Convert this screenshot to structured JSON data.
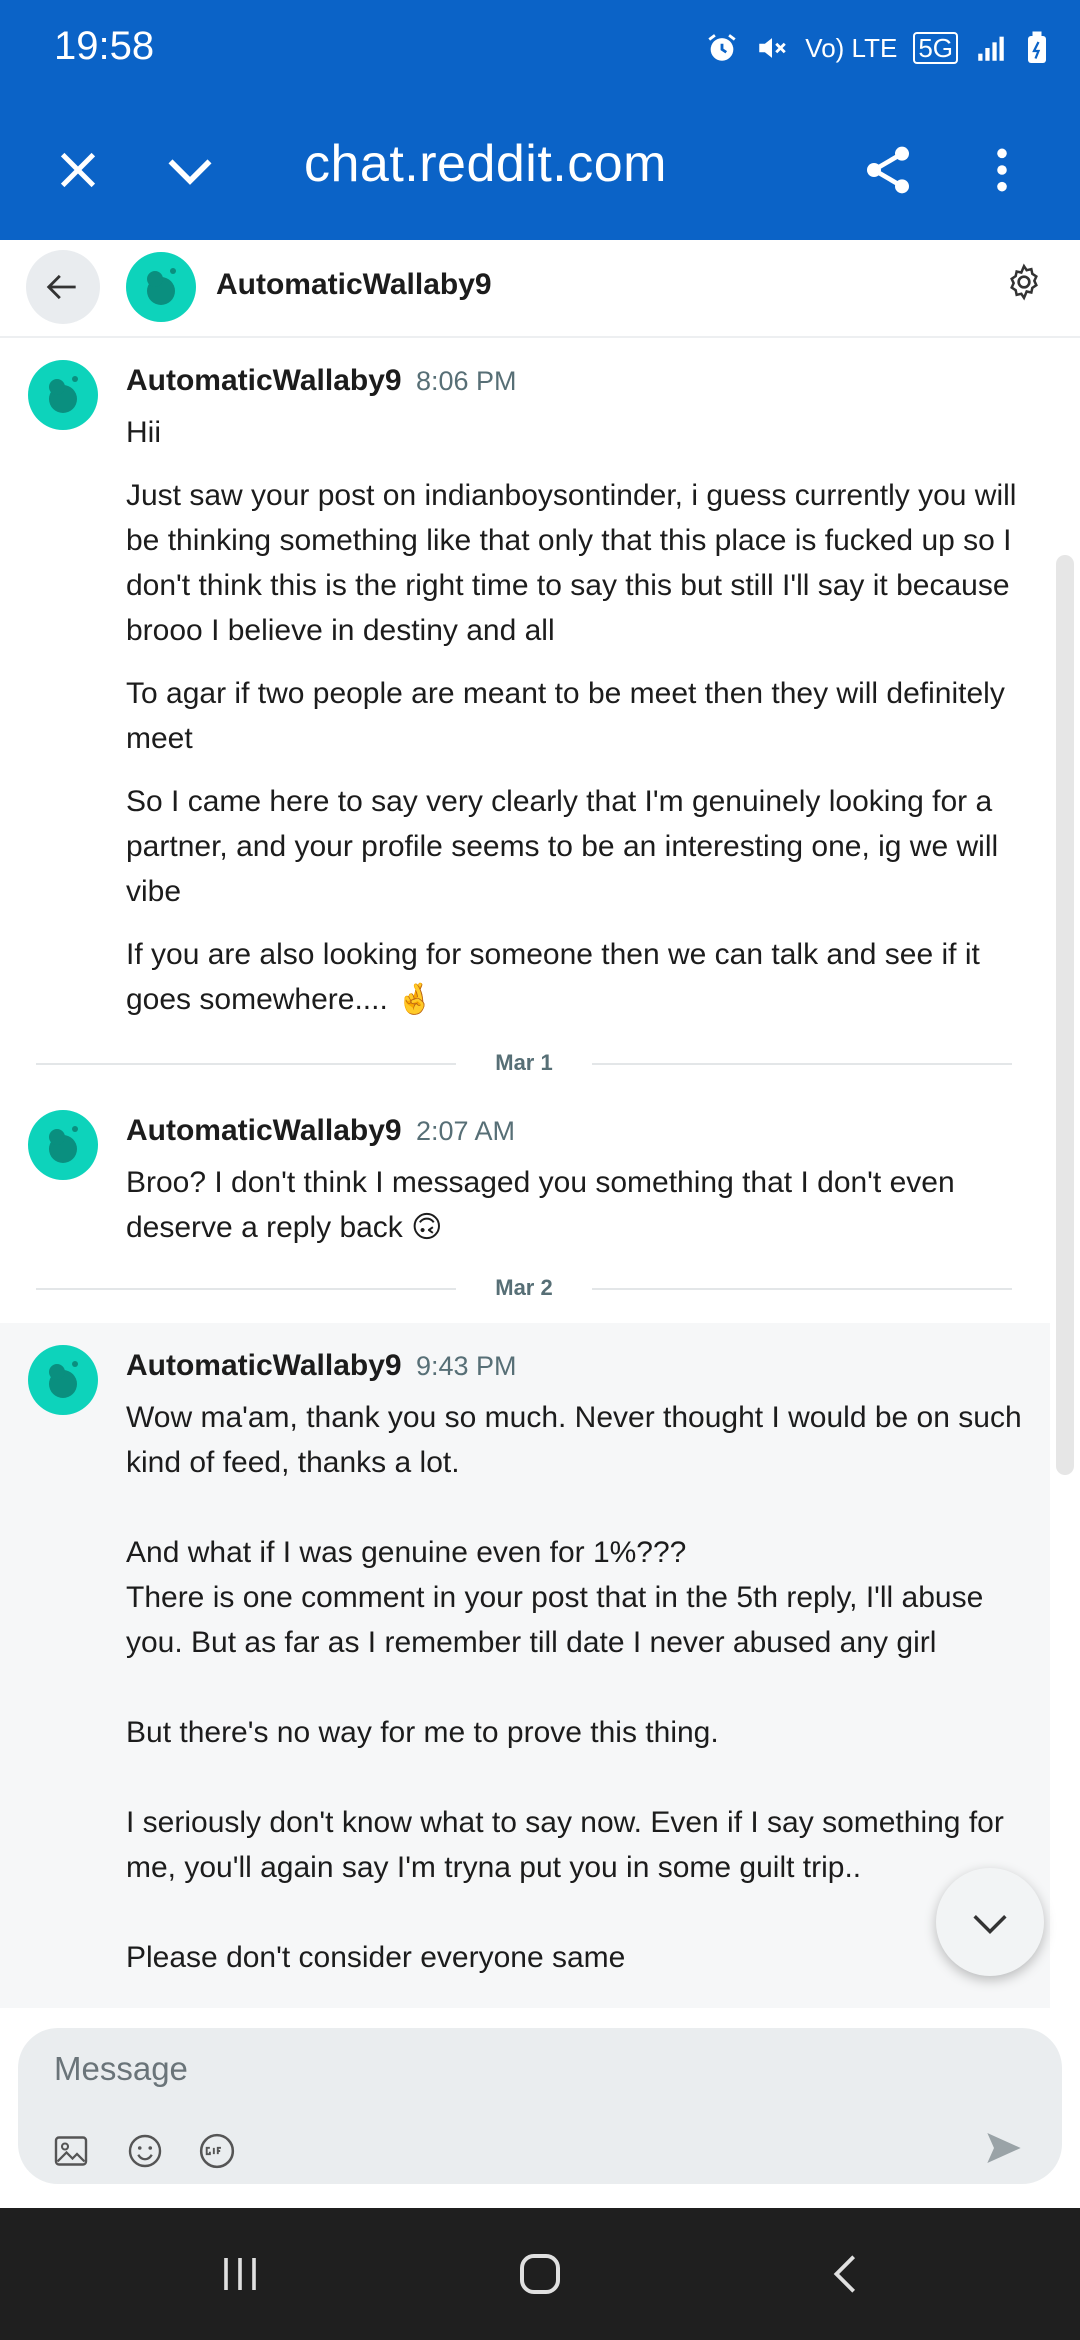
{
  "status": {
    "time": "19:58",
    "icons": [
      "alarm-icon",
      "mute-icon",
      "volte-icon",
      "5g-icon",
      "signal-icon",
      "battery-icon"
    ],
    "volte_text": "Vo) LTE",
    "net_text": "5G"
  },
  "browser": {
    "url": "chat.reddit.com",
    "accent": "#0b63c7"
  },
  "chat": {
    "user": "AutomaticWallaby9",
    "avatar_color": "#0dd3bb"
  },
  "messages": [
    {
      "author": "AutomaticWallaby9",
      "time": "8:06 PM",
      "paragraphs": [
        "Hii",
        "Just saw your post on indianboysontinder, i guess currently you will be thinking something like that only that this place is fucked up so I don't think this is the right time to say this but still I'll say it because brooo I believe in destiny and all",
        "To agar if two people are meant to be meet then they will definitely meet",
        "So I came here to say very clearly that I'm genuinely looking for a partner, and your profile seems to be an interesting one, ig we will vibe",
        "If you are also looking for someone then we can talk and see if it goes somewhere.... 🤞"
      ]
    },
    {
      "author": "AutomaticWallaby9",
      "time": "2:07 AM",
      "paragraphs": [
        "Broo? I don't think I messaged you something that I don't even deserve a reply back 🙃"
      ]
    },
    {
      "author": "AutomaticWallaby9",
      "time": "9:43 PM",
      "paragraphs": [
        "Wow ma'am, thank you so much. Never thought I would be on such kind of feed, thanks a lot.\n\nAnd what if I was genuine even for 1%???\nThere is one comment in your post that in the 5th reply, I'll abuse you. But as far as I remember till date I never abused any girl\n\nBut there's no way for me to prove this thing.\n\nI seriously don't know what to say now. Even if I say something for me, you'll again say I'm tryna put you in some guilt trip..\n\nPlease don't consider everyone same"
      ]
    }
  ],
  "date_separators": [
    "Mar 1",
    "Mar 2"
  ],
  "composer": {
    "placeholder": "Message"
  }
}
